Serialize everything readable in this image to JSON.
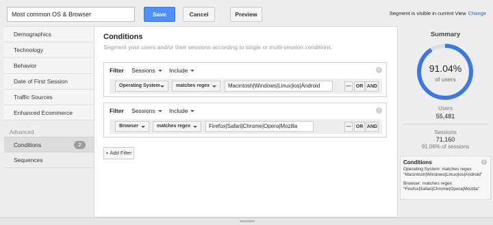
{
  "topbar": {
    "segment_name": "Most common OS & Browser",
    "save_label": "Save",
    "cancel_label": "Cancel",
    "preview_label": "Preview",
    "visibility_text": "Segment is visible in current View",
    "change_label": "Change"
  },
  "sidebar": {
    "items": [
      {
        "label": "Demographics"
      },
      {
        "label": "Technology"
      },
      {
        "label": "Behavior"
      },
      {
        "label": "Date of First Session"
      },
      {
        "label": "Traffic Sources"
      },
      {
        "label": "Enhanced Ecommerce"
      }
    ],
    "advanced_label": "Advanced",
    "advanced_items": [
      {
        "label": "Conditions",
        "badge": "2"
      },
      {
        "label": "Sequences"
      }
    ]
  },
  "main": {
    "title": "Conditions",
    "subtitle": "Segment your users and/or their sessions according to single or multi-session conditions.",
    "filters": [
      {
        "filter_label": "Filter",
        "scope": "Sessions",
        "mode": "Include",
        "dimension": "Operating System",
        "operator": "matches regex",
        "value": "Macintosh|Windows|Linux|ios|Android",
        "minus_label": "—",
        "or_label": "OR",
        "and_label": "AND"
      },
      {
        "filter_label": "Filter",
        "scope": "Sessions",
        "mode": "Include",
        "dimension": "Browser",
        "operator": "matches regex",
        "value": "Firefox|Safari|Chrome|Opera|Mozilla",
        "minus_label": "—",
        "or_label": "OR",
        "and_label": "AND"
      }
    ],
    "add_filter_label": "+ Add Filter"
  },
  "summary": {
    "title": "Summary",
    "percent": "91.04%",
    "percent_value": 0.9104,
    "percent_sub": "of users",
    "users_label": "Users",
    "users_value": "55,481",
    "sessions_label": "Sessions",
    "sessions_value": "71,160",
    "sessions_pct": "91.06% of sessions",
    "conditions_title": "Conditions",
    "condition_lines": [
      "Operating System: matches regex \"Macintosh|Windows|Linux|ios|Android\"",
      "Browser: matches regex \"Firefox|Safari|Chrome|Opera|Mozilla\""
    ],
    "colors": {
      "donut_fill": "#3b78e7",
      "donut_track": "#dddddd"
    }
  }
}
